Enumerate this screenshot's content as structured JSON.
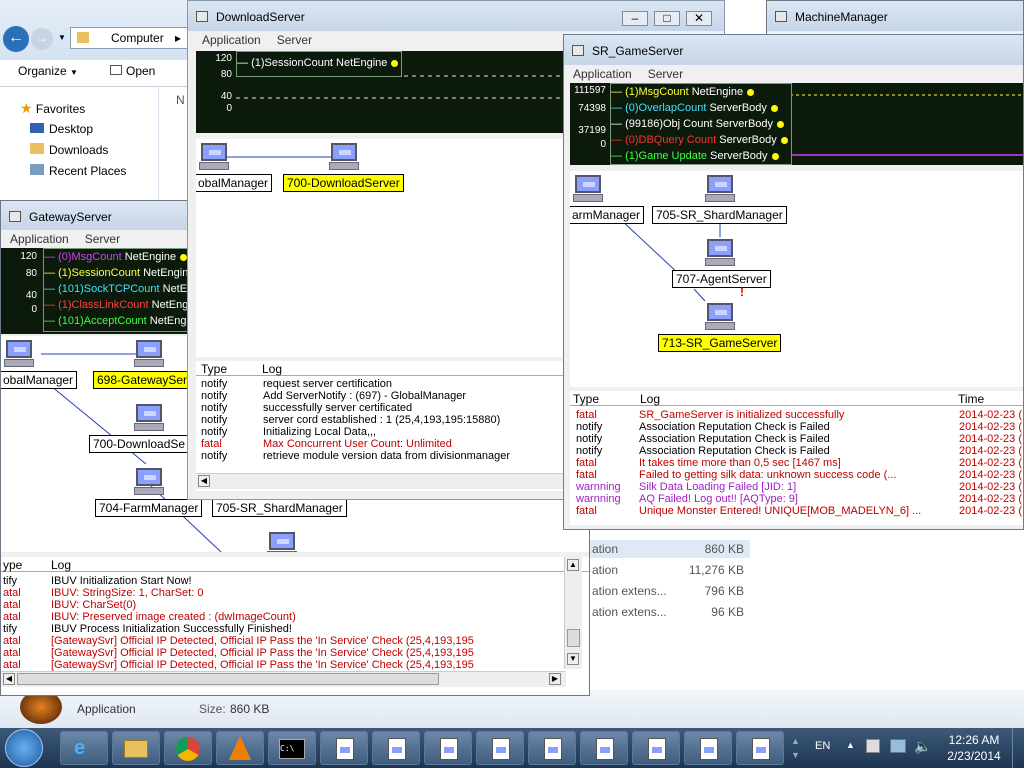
{
  "explorer": {
    "address": "Computer",
    "organize": "Organize",
    "open": "Open",
    "nav_frag": "N",
    "favorites": [
      {
        "label": "Favorites"
      },
      {
        "label": "Desktop"
      },
      {
        "label": "Downloads"
      },
      {
        "label": "Recent Places"
      }
    ],
    "rows": [
      {
        "name": "ation",
        "size": "860 KB"
      },
      {
        "name": "ation",
        "size": "11,276 KB"
      },
      {
        "name": "ation extens...",
        "size": "796 KB"
      },
      {
        "name": "ation extens...",
        "size": "96 KB"
      }
    ],
    "details": {
      "type": "Application",
      "size_label": "Size:",
      "size_value": "860 KB"
    }
  },
  "machine_manager": {
    "title": "MachineManager"
  },
  "download_server": {
    "title": "DownloadServer",
    "menu": [
      "Application",
      "Server"
    ],
    "axis": [
      "120",
      "80",
      "40",
      "0"
    ],
    "legend": [
      {
        "text": "(1)SessionCount NetEngine",
        "color": "#ffffff"
      }
    ],
    "nodes": [
      {
        "label": "obalManager"
      },
      {
        "label": "700-DownloadServer"
      }
    ],
    "log_headers": [
      "Type",
      "Log"
    ],
    "log": [
      {
        "type": "notify",
        "text": "request server certification",
        "level": "notify"
      },
      {
        "type": "notify",
        "text": "Add ServerNotify : (697) - GlobalManager",
        "level": "notify"
      },
      {
        "type": "notify",
        "text": "successfully server certificated",
        "level": "notify"
      },
      {
        "type": "notify",
        "text": "server cord established : 1 (25,4,193,195:15880)",
        "level": "notify"
      },
      {
        "type": "notify",
        "text": "Initializing Local Data,,,",
        "level": "notify"
      },
      {
        "type": "fatal",
        "text": "Max Concurrent User Count: Unlimited",
        "level": "fatal"
      },
      {
        "type": "notify",
        "text": "retrieve module version data from divisionmanager",
        "level": "notify"
      }
    ]
  },
  "gateway_server": {
    "title": "GatewayServer",
    "menu": [
      "Application",
      "Server"
    ],
    "axis": [
      "120",
      "80",
      "40",
      "0"
    ],
    "legend": [
      {
        "prefix": "(0)",
        "name": "MsgCount",
        "suffix": " NetEngine",
        "color": "#d040ff"
      },
      {
        "prefix": "(1)",
        "name": "SessionCount",
        "suffix": " NetEngin",
        "color": "#ffff40"
      },
      {
        "prefix": "(101)",
        "name": "SockTCPCount",
        "suffix": " NetEn",
        "color": "#40e0ff"
      },
      {
        "prefix": "(1)",
        "name": "ClassLinkCount",
        "suffix": " NetEngi",
        "color": "#ff4040"
      },
      {
        "prefix": "(101)",
        "name": "AcceptCount",
        "suffix": " NetEng",
        "color": "#40ff40"
      }
    ],
    "nodes": [
      {
        "label": "obalManager"
      },
      {
        "label": "698-GatewaySer"
      },
      {
        "label": "700-DownloadSe"
      },
      {
        "label": "704-FarmManager"
      },
      {
        "label": "705-SR_ShardManager"
      }
    ],
    "log_headers": [
      "ype",
      "Log"
    ],
    "log": [
      {
        "type": "tify",
        "text": "IBUV Initialization Start Now!",
        "level": "notify"
      },
      {
        "type": "atal",
        "text": "IBUV: StringSize: 1, CharSet: 0",
        "level": "fatal"
      },
      {
        "type": "atal",
        "text": "IBUV: CharSet(0)",
        "level": "fatal"
      },
      {
        "type": "atal",
        "text": "IBUV: Preserved image created : (dwImageCount)",
        "level": "fatal"
      },
      {
        "type": "tify",
        "text": "IBUV Process Initialization Successfully Finished!",
        "level": "notify"
      },
      {
        "type": "atal",
        "text": "[GatewaySvr] Official IP Detected, Official IP Pass the 'In Service' Check (25,4,193,195",
        "level": "fatal"
      },
      {
        "type": "atal",
        "text": "[GatewaySvr] Official IP Detected, Official IP Pass the 'In Service' Check (25,4,193,195",
        "level": "fatal"
      },
      {
        "type": "atal",
        "text": "[GatewaySvr] Official IP Detected, Official IP Pass the 'In Service' Check (25,4,193,195",
        "level": "fatal"
      }
    ]
  },
  "game_server": {
    "title": "SR_GameServer",
    "menu": [
      "Application",
      "Server"
    ],
    "axis": [
      "111597",
      "74398",
      "37199",
      "0"
    ],
    "legend": [
      {
        "prefix": "(1)",
        "name": "MsgCount",
        "suffix": " NetEngine",
        "color": "#ffff40"
      },
      {
        "prefix": "(0)",
        "name": "OverlapCount",
        "suffix": " ServerBody",
        "color": "#40e0ff"
      },
      {
        "prefix": "(99186)",
        "name": "Obj Count",
        "suffix": " ServerBody",
        "color": "#ffffff"
      },
      {
        "prefix": "(0)",
        "name": "DBQuery Count",
        "suffix": " ServerBody",
        "color": "#ff3030"
      },
      {
        "prefix": "(1)",
        "name": "Game Update",
        "suffix": " ServerBody",
        "color": "#40ff40"
      }
    ],
    "nodes": [
      {
        "label": "armManager"
      },
      {
        "label": "705-SR_ShardManager"
      },
      {
        "label": "707-AgentServer"
      },
      {
        "label": "713-SR_GameServer"
      }
    ],
    "log_headers": [
      "Type",
      "Log",
      "Time"
    ],
    "log": [
      {
        "type": "fatal",
        "text": "SR_GameServer is initialized successfully",
        "time": "2014-02-23 (",
        "level": "fatal"
      },
      {
        "type": "notify",
        "text": "Association Reputation Check is Failed",
        "time": "2014-02-23 (",
        "level": "notify"
      },
      {
        "type": "notify",
        "text": "Association Reputation Check is Failed",
        "time": "2014-02-23 (",
        "level": "notify"
      },
      {
        "type": "notify",
        "text": "Association Reputation Check is Failed",
        "time": "2014-02-23 (",
        "level": "notify"
      },
      {
        "type": "fatal",
        "text": "It takes time more than 0,5 sec [1467 ms]",
        "time": "2014-02-23 (",
        "level": "fatal"
      },
      {
        "type": "fatal",
        "text": "Failed to getting silk data: unknown success code (...",
        "time": "2014-02-23 (",
        "level": "fatal"
      },
      {
        "type": "warnning",
        "text": "Silk Data Loading Failed [JID: 1]",
        "time": "2014-02-23 (",
        "level": "warn"
      },
      {
        "type": "warnning",
        "text": "AQ Failed! Log out!! [AQType: 9]",
        "time": "2014-02-23 (",
        "level": "warn"
      },
      {
        "type": "fatal",
        "text": "Unique Monster Entered! UNIQUE[MOB_MADELYN_6] ...",
        "time": "2014-02-23 (",
        "level": "fatal"
      }
    ]
  },
  "taskbar": {
    "lang": "EN",
    "time": "12:26 AM",
    "date": "2/23/2014"
  },
  "colors": {
    "fatal": "#c00000",
    "notify": "#000000",
    "warn": "#a020c0",
    "selected_label": "#ffff00",
    "chart_bg": "#0c1a0c"
  }
}
